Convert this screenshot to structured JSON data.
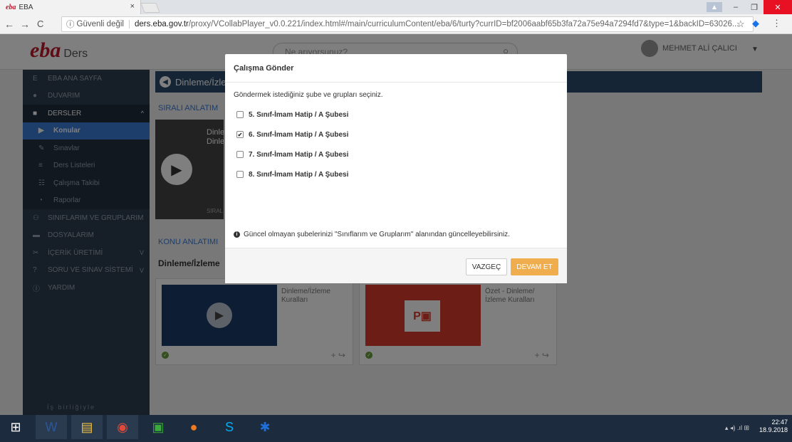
{
  "browser": {
    "tab_title": "EBA",
    "tab_favicon": "eba",
    "tab_close": "×",
    "security_label": "Güvenli değil",
    "url_domain": "ders.eba.gov.tr",
    "url_path": "/proxy/VCollabPlayer_v0.0.221/index.html#/main/curriculumContent/eba/6/turty?currID=bf2006aabf65b3fa72a75e94a7294fd7&type=1&backID=63026..."
  },
  "header": {
    "logo_main": "eba",
    "logo_sub": "Ders",
    "search_placeholder": "Ne arıyorsunuz?",
    "user_name": "MEHMET ALİ ÇALICI"
  },
  "sidebar": {
    "items": [
      {
        "label": "EBA ANA SAYFA",
        "icon": "eba-logo-icon"
      },
      {
        "label": "DUVARIM",
        "icon": "user-icon"
      },
      {
        "label": "DERSLER",
        "icon": "book-icon"
      },
      {
        "label": "Konular",
        "icon": "play-circle-icon"
      },
      {
        "label": "Sınavlar",
        "icon": "pencil-icon"
      },
      {
        "label": "Ders Listeleri",
        "icon": "list-icon"
      },
      {
        "label": "Çalışma Takibi",
        "icon": "tracking-icon"
      },
      {
        "label": "Raporlar",
        "icon": "pie-chart-icon"
      },
      {
        "label": "SINIFLARIM VE GRUPLARIM",
        "icon": "group-icon"
      },
      {
        "label": "DOSYALARIM",
        "icon": "folder-icon"
      },
      {
        "label": "İÇERİK ÜRETİMİ",
        "icon": "tools-icon"
      },
      {
        "label": "SORU VE SINAV SİSTEMİ",
        "icon": "question-icon"
      },
      {
        "label": "YARDIM",
        "icon": "info-icon"
      }
    ],
    "footer": "İş birliğiyle"
  },
  "content": {
    "title": "Dinleme/İzle",
    "section1_label": "SIRALI ANLATIM",
    "video_text": "Dinle\nDinle",
    "video_caption": "SIRAL",
    "section2_label": "KONU ANLATIMI",
    "section_title": "Dinleme/İzleme",
    "cards": [
      {
        "text": "Dinleme/İzleme Kuralları"
      },
      {
        "text": "Özet - Dinleme/ İzleme Kuralları"
      }
    ]
  },
  "modal": {
    "title": "Çalışma Gönder",
    "description": "Göndermek istediğiniz şube ve grupları seçiniz.",
    "options": [
      {
        "label": "5. Sınıf-İmam Hatip / A Şubesi",
        "checked": false
      },
      {
        "label": "6. Sınıf-İmam Hatip / A Şubesi",
        "checked": true
      },
      {
        "label": "7. Sınıf-İmam Hatip / A Şubesi",
        "checked": false
      },
      {
        "label": "8. Sınıf-İmam Hatip / A Şubesi",
        "checked": false
      }
    ],
    "note": "Güncel olmayan şubelerinizi \"Sınıflarım ve Gruplarım\" alanından güncelleyebilirsiniz.",
    "cancel_label": "VAZGEÇ",
    "ok_label": "DEVAM ET",
    "ok_color": "#f0ad4e"
  },
  "taskbar": {
    "time": "22:47",
    "date": "18.9.2018"
  }
}
